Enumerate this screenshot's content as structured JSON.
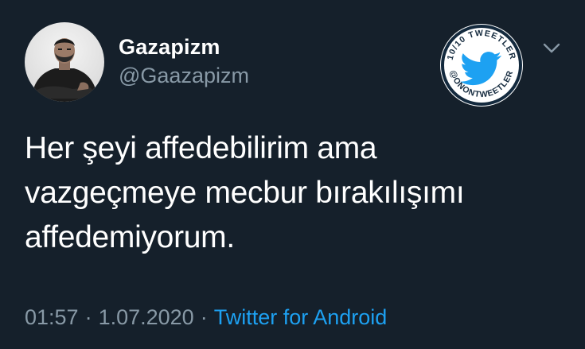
{
  "author": {
    "display_name": "Gazapizm",
    "handle": "@Gaazapizm",
    "avatar_icon": "user-photo-avatar"
  },
  "badge": {
    "ring_text_top": "10/10 TWEETLER",
    "ring_text_bottom": "@ONONTWEETLER",
    "icon": "twitter-bird-icon",
    "color": "#1da1f2"
  },
  "tweet": {
    "lines": [
      "Her şeyi affedebilirim ama",
      "vazgeçmeye mecbur bırakılışımı",
      "affedemiyorum."
    ],
    "time": "01:57",
    "separator": "·",
    "date": "1.07.2020",
    "source": "Twitter for Android"
  },
  "colors": {
    "background": "#15202b",
    "primary_text": "#ffffff",
    "secondary_text": "#8899a6",
    "accent": "#1da1f2"
  }
}
